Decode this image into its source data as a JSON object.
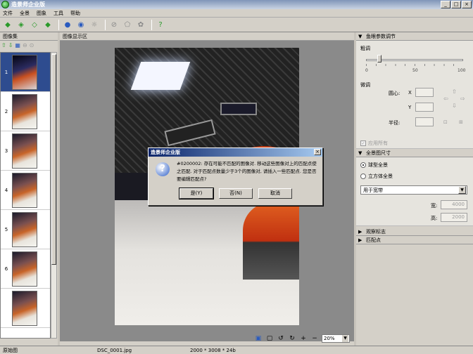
{
  "window": {
    "title": "造景师企业版",
    "controls": [
      "_",
      "□",
      "×"
    ]
  },
  "menu": [
    "文件",
    "全景",
    "图象",
    "工具",
    "帮助"
  ],
  "toolbar_icons": [
    "open-icon",
    "save-icon",
    "export-icon",
    "tag-icon",
    "globe-icon",
    "globe-alt-icon",
    "preview-icon",
    "rotate-icon",
    "stitch-icon",
    "settings-icon",
    "help-icon"
  ],
  "image_set": {
    "header": "图像集",
    "items": [
      {
        "num": "1",
        "selected": true
      },
      {
        "num": "2",
        "selected": false
      },
      {
        "num": "3",
        "selected": false
      },
      {
        "num": "4",
        "selected": false
      },
      {
        "num": "5",
        "selected": false
      },
      {
        "num": "6",
        "selected": false
      },
      {
        "num": "",
        "selected": false
      }
    ]
  },
  "display": {
    "header": "图像显示区",
    "zoom": "20%"
  },
  "fisheye": {
    "header": "鱼眼参数调节",
    "coarse": "粗调",
    "tick_labels": [
      "0",
      "50",
      "100"
    ],
    "fine": "微调",
    "center": "圆心:",
    "x": "X",
    "y": "Y",
    "radius": "半径:",
    "apply_all": "应用所有"
  },
  "panorama_size": {
    "header": "全景图尺寸",
    "spherical": "球型全景",
    "cubic": "立方体全景",
    "usage": "用于宽带",
    "width_label": "宽:",
    "width_value": "4000",
    "height_label": "高:",
    "height_value": "2000"
  },
  "collapsed_sections": [
    "观察标志",
    "匹配点"
  ],
  "status": {
    "view": "原始图",
    "file": "DSC_0001.jpg",
    "info": "2000 * 3008 * 24b"
  },
  "dialog": {
    "title": "造景师企业版",
    "message": "#0200002: 存在可能不匹配的图像对. 移动这些图像对上的匹配点使之匹配. 对于匹配点数量少于3个的图像对, 请插入一些匹配点. 您是否要编辑匹配点?",
    "yes": "是(Y)",
    "no": "否(N)",
    "cancel": "取消"
  }
}
